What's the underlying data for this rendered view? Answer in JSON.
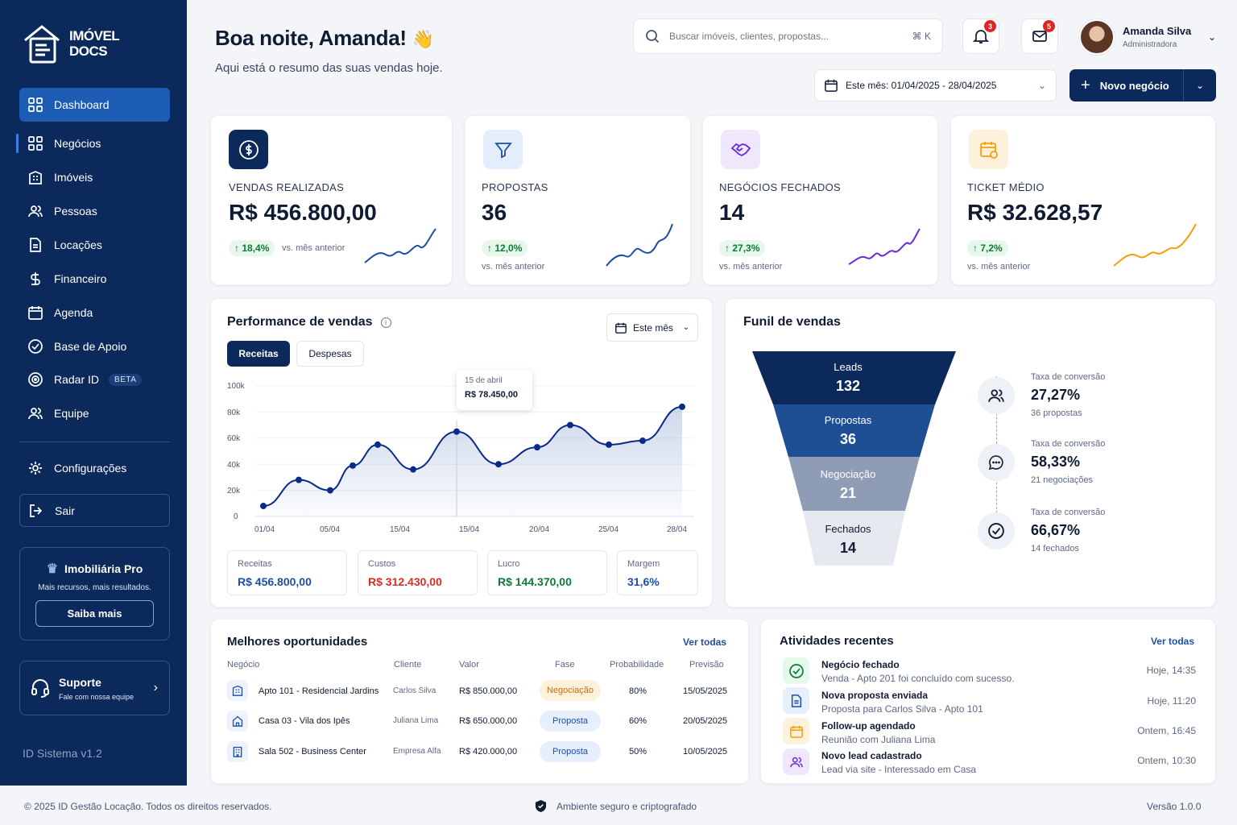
{
  "brand": {
    "line1": "IMÓVEL",
    "line2": "DOCS"
  },
  "nav": [
    {
      "label": "Dashboard",
      "icon": "grid-icon"
    },
    {
      "label": "Negócios",
      "icon": "grid-icon"
    },
    {
      "label": "Imóveis",
      "icon": "building-icon"
    },
    {
      "label": "Pessoas",
      "icon": "users-icon"
    },
    {
      "label": "Locações",
      "icon": "document-icon"
    },
    {
      "label": "Financeiro",
      "icon": "dollar-icon"
    },
    {
      "label": "Agenda",
      "icon": "calendar-icon"
    },
    {
      "label": "Base de Apoio",
      "icon": "check-circle-icon"
    },
    {
      "label": "Radar ID",
      "icon": "radar-icon",
      "badge": "BETA"
    },
    {
      "label": "Equipe",
      "icon": "team-icon"
    }
  ],
  "settings": "Configurações",
  "logout": "Sair",
  "promo": {
    "title": "Imobiliária Pro",
    "subtitle": "Mais recursos, mais resultados.",
    "button": "Saiba mais"
  },
  "support": {
    "title": "Suporte",
    "subtitle": "Fale com nossa equipe"
  },
  "system_version": "ID Sistema   v1.2",
  "header": {
    "greeting": "Boa noite, Amanda!",
    "emoji": "👋",
    "subtitle": "Aqui está o resumo das suas vendas hoje."
  },
  "search": {
    "placeholder": "Buscar imóveis, clientes, propostas...",
    "shortcut": "⌘ K"
  },
  "notifications": {
    "bell_count": "3",
    "mail_count": "5"
  },
  "user": {
    "name": "Amanda Silva",
    "role": "Administradora"
  },
  "date_filter": "Este mês: 01/04/2025 - 28/04/2025",
  "new_deal": "Novo negócio",
  "kpis": [
    {
      "label": "VENDAS REALIZADAS",
      "value": "R$ 456.800,00",
      "change": "18,4%",
      "vs": "vs. mês anterior",
      "color": "#1d4fa3"
    },
    {
      "label": "PROPOSTAS",
      "value": "36",
      "change": "12,0%",
      "vs": "vs. mês anterior",
      "color": "#1d4fa3"
    },
    {
      "label": "NEGÓCIOS FECHADOS",
      "value": "14",
      "change": "27,3%",
      "vs": "vs. mês anterior",
      "color": "#6d28d9"
    },
    {
      "label": "TICKET MÉDIO",
      "value": "R$ 32.628,57",
      "change": "7,2%",
      "vs": "vs. mês anterior",
      "color": "#f59e0b"
    }
  ],
  "performance": {
    "title": "Performance de vendas",
    "period": "Este mês",
    "tab_revenue": "Receitas",
    "tab_expenses": "Despesas",
    "tooltip": {
      "date": "15 de abril",
      "value": "R$ 78.450,00"
    },
    "summary": [
      {
        "label": "Receitas",
        "value": "R$ 456.800,00",
        "color": "#1d4fa3"
      },
      {
        "label": "Custos",
        "value": "R$ 312.430,00",
        "color": "#d92d20"
      },
      {
        "label": "Lucro",
        "value": "R$ 144.370,00",
        "color": "#0e7a3a"
      },
      {
        "label": "Margem",
        "value": "31,6%",
        "color": "#1d4fa3"
      }
    ]
  },
  "chart_data": {
    "type": "area",
    "series": [
      {
        "values": [
          8000,
          28000,
          20000,
          39000,
          55000,
          36000,
          65000,
          40000,
          53000,
          70000,
          55000,
          58000,
          84000
        ]
      }
    ],
    "x": [
      "01/04",
      "03/04",
      "05/04",
      "07/04",
      "09/04",
      "12/04",
      "15/04",
      "18/04",
      "20/04",
      "22/04",
      "24/04",
      "26/04",
      "28/04"
    ],
    "xticks": [
      "01/04",
      "05/04",
      "15/04",
      "15/04",
      "20/04",
      "25/04",
      "28/04"
    ],
    "yticks": [
      "100k",
      "80k",
      "60k",
      "40k",
      "20k",
      "0"
    ],
    "ylim": [
      0,
      100000
    ]
  },
  "funnel": {
    "title": "Funil de vendas",
    "stages": [
      {
        "label": "Leads",
        "value": "132"
      },
      {
        "label": "Propostas",
        "value": "36"
      },
      {
        "label": "Negociação",
        "value": "21"
      },
      {
        "label": "Fechados",
        "value": "14"
      }
    ],
    "conversions": [
      {
        "label": "Taxa de conversão",
        "value": "27,27%",
        "sub": "36 propostas",
        "icon": "users-icon"
      },
      {
        "label": "Taxa de conversão",
        "value": "58,33%",
        "sub": "21 negociações",
        "icon": "chat-icon"
      },
      {
        "label": "Taxa de conversão",
        "value": "66,67%",
        "sub": "14 fechados",
        "icon": "check-circle-icon"
      }
    ]
  },
  "opportunities": {
    "title": "Melhores oportunidades",
    "see_all": "Ver todas",
    "headers": [
      "Negócio",
      "Cliente",
      "Valor",
      "Fase",
      "Probabilidade",
      "Previsão"
    ],
    "rows": [
      {
        "deal": "Apto 101 - Residencial Jardins",
        "client": "Carlos Silva",
        "value": "R$ 850.000,00",
        "phase": "Negociação",
        "prob": "80%",
        "date": "15/05/2025",
        "icon": "building-icon"
      },
      {
        "deal": "Casa 03 - Vila dos Ipês",
        "client": "Juliana Lima",
        "value": "R$ 650.000,00",
        "phase": "Proposta",
        "prob": "60%",
        "date": "20/05/2025",
        "icon": "house-icon"
      },
      {
        "deal": "Sala 502 - Business Center",
        "client": "Empresa Alfa",
        "value": "R$ 420.000,00",
        "phase": "Proposta",
        "prob": "50%",
        "date": "10/05/2025",
        "icon": "office-icon"
      }
    ]
  },
  "activities": {
    "title": "Atividades recentes",
    "see_all": "Ver todas",
    "items": [
      {
        "title": "Negócio fechado",
        "sub": "Venda - Apto 201 foi concluído com sucesso.",
        "time": "Hoje, 14:35",
        "icon": "check-circle-icon"
      },
      {
        "title": "Nova proposta enviada",
        "sub": "Proposta para Carlos Silva - Apto 101",
        "time": "Hoje, 11:20",
        "icon": "document-icon"
      },
      {
        "title": "Follow-up agendado",
        "sub": "Reunião com Juliana Lima",
        "time": "Ontem, 16:45",
        "icon": "calendar-icon"
      },
      {
        "title": "Novo lead cadastrado",
        "sub": "Lead via site - Interessado em Casa",
        "time": "Ontem, 10:30",
        "icon": "users-icon"
      }
    ]
  },
  "footer": {
    "copyright": "© 2025 ID Gestão Locação. Todos os direitos reservados.",
    "secure": "Ambiente seguro e criptografado",
    "version": "Versão 1.0.0"
  }
}
